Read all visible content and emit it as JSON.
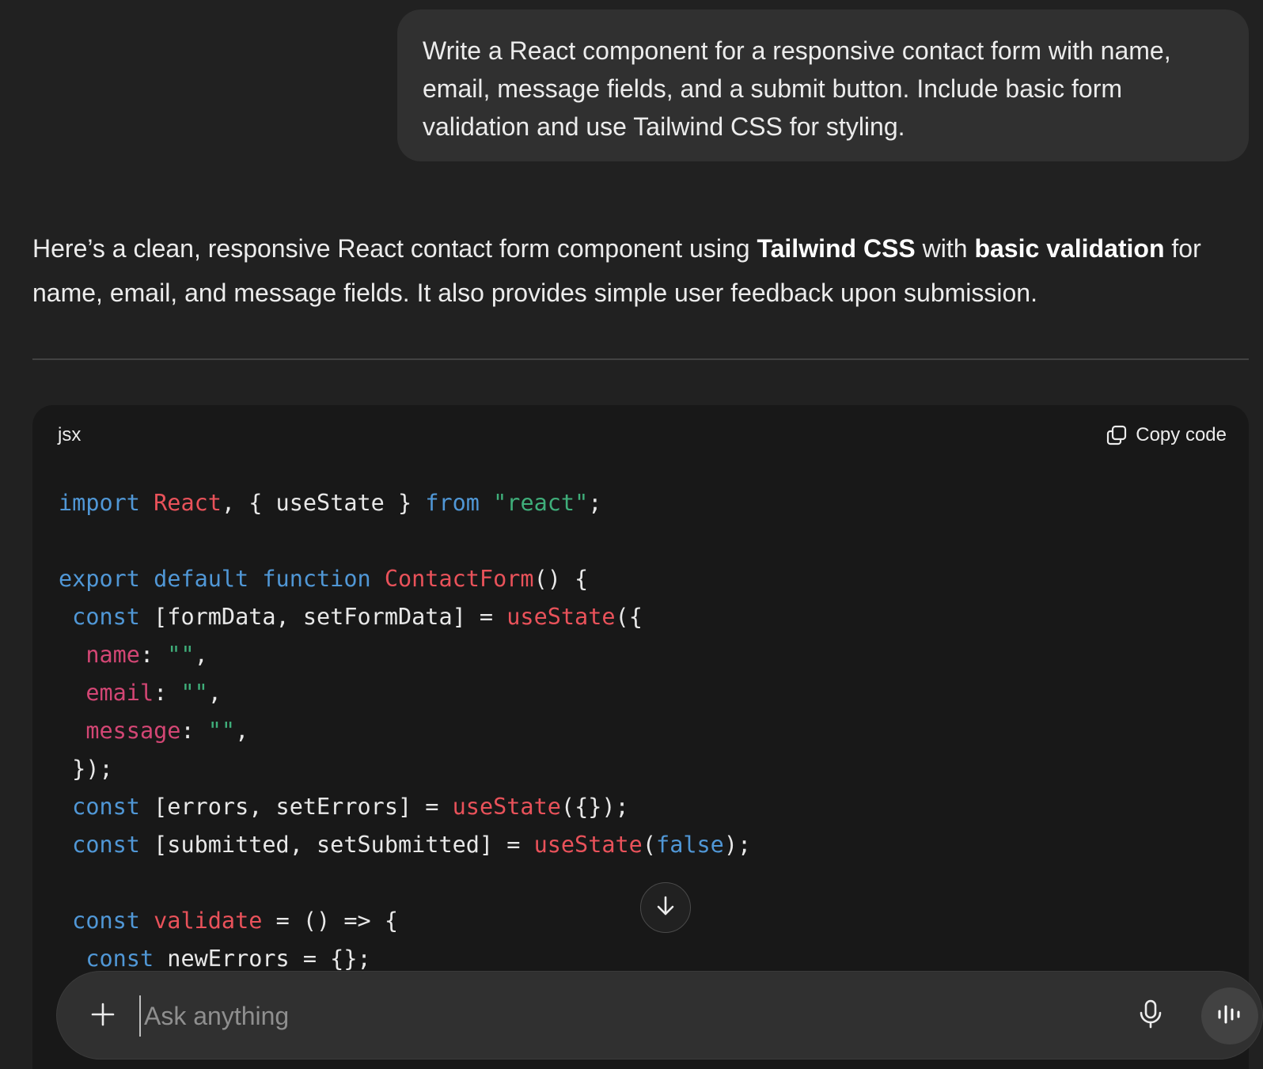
{
  "user_message": {
    "text": "Write a React component for a responsive contact form with name, email, message fields, and a submit button. Include basic form validation and use Tailwind CSS for styling."
  },
  "assistant_reply": {
    "part1": "Here’s a clean, responsive React contact form component using ",
    "bold1": "Tailwind CSS",
    "part2": " with ",
    "bold2": "basic validation",
    "part3": " for name, email, and message fields. It also provides simple user feedback upon submission."
  },
  "code_block": {
    "language": "jsx",
    "copy_label": "Copy code",
    "lines": [
      [
        [
          "kw",
          "import"
        ],
        [
          "",
          "  "
        ],
        [
          "fn",
          "React"
        ],
        [
          "",
          ", { useState } "
        ],
        [
          "kw",
          "from"
        ],
        [
          "",
          "  "
        ],
        [
          "str",
          "\"react\""
        ],
        [
          "",
          ";"
        ]
      ],
      [],
      [
        [
          "kw",
          "export default function"
        ],
        [
          "",
          "  "
        ],
        [
          "fn",
          "ContactForm"
        ],
        [
          "",
          "() {"
        ]
      ],
      [
        [
          "",
          "  "
        ],
        [
          "kw",
          "const"
        ],
        [
          "",
          "  [formData, setFormData] = "
        ],
        [
          "fn",
          "useState"
        ],
        [
          "",
          "({"
        ]
      ],
      [
        [
          "",
          "    "
        ],
        [
          "prop",
          "name"
        ],
        [
          "",
          ": "
        ],
        [
          "str",
          "\"\""
        ],
        [
          "",
          ","
        ]
      ],
      [
        [
          "",
          "    "
        ],
        [
          "prop",
          "email"
        ],
        [
          "",
          ": "
        ],
        [
          "str",
          "\"\""
        ],
        [
          "",
          ","
        ]
      ],
      [
        [
          "",
          "    "
        ],
        [
          "prop",
          "message"
        ],
        [
          "",
          ": "
        ],
        [
          "str",
          "\"\""
        ],
        [
          "",
          ","
        ]
      ],
      [
        [
          "",
          "  });"
        ]
      ],
      [
        [
          "",
          "  "
        ],
        [
          "kw",
          "const"
        ],
        [
          "",
          "  [errors, setErrors] = "
        ],
        [
          "fn",
          "useState"
        ],
        [
          "",
          "({});"
        ]
      ],
      [
        [
          "",
          "  "
        ],
        [
          "kw",
          "const"
        ],
        [
          "",
          "  [submitted, setSubmitted] = "
        ],
        [
          "fn",
          "useState"
        ],
        [
          "",
          "("
        ],
        [
          "kw",
          "false"
        ],
        [
          "",
          ");"
        ]
      ],
      [],
      [
        [
          "",
          "  "
        ],
        [
          "kw",
          "const"
        ],
        [
          "",
          "  "
        ],
        [
          "fn",
          "validate"
        ],
        [
          "",
          "  = () => {"
        ]
      ],
      [
        [
          "",
          "    "
        ],
        [
          "kw",
          "const"
        ],
        [
          "",
          "  newErrors = {};"
        ]
      ]
    ]
  },
  "composer": {
    "placeholder": "Ask anything"
  },
  "icons": {
    "copy": "copy-icon",
    "scroll_down": "arrow-down-icon",
    "plus": "plus-icon",
    "mic": "microphone-icon",
    "voice": "voice-waveform-icon"
  }
}
